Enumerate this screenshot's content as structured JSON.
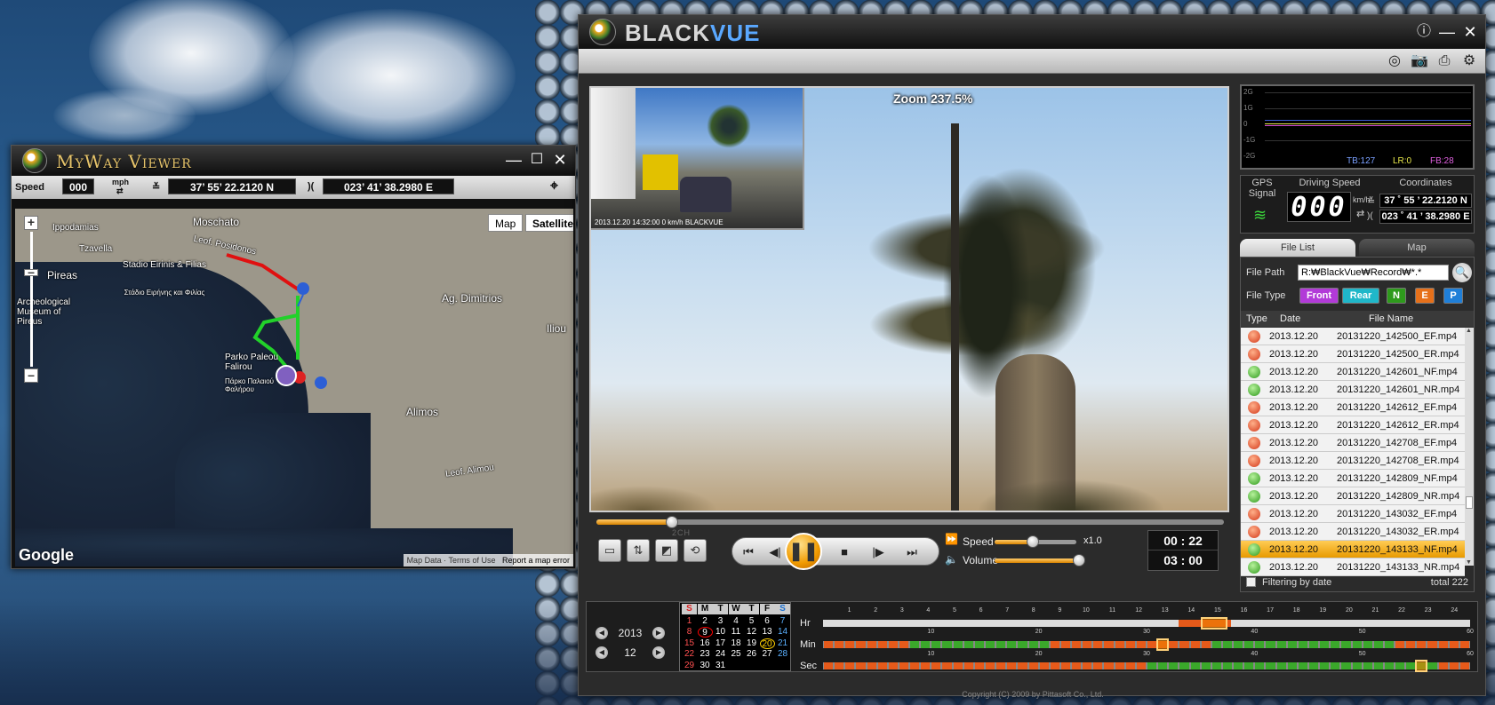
{
  "myway": {
    "title": "MyWay Viewer",
    "speed_label": "Speed",
    "speed_value": "000",
    "speed_unit": "mph",
    "lat": "37’ 55’ 22.2120 N",
    "lon": "023’ 41’ 38.2980 E",
    "map_btn": "Map",
    "satellite_btn": "Satellite",
    "labels": {
      "moschato": "Moschato",
      "pireas": "Pireas",
      "tzavella": "Tzavella",
      "stadio": "Stadio Eirinis & Filias",
      "stadio_gr": "Στάδιο Ειρήνης και Φιλίας",
      "ag_dimitrios": "Ag. Dimitrios",
      "iliou": "Iliou",
      "parko": "Parko Paleou Falirou",
      "parko_gr": "Πάρκο Παλαιού Φαλήρου",
      "alimos": "Alimos",
      "poseidonos": "Leof. Posidonos",
      "lefkimou": "Leof. Alimou",
      "ippodamias": "Ippodamias",
      "museum": "Archeological Museum of Pireus"
    },
    "footer": {
      "map_data": "Map Data",
      "terms": "Terms of Use",
      "report": "Report a map error"
    },
    "google": "Google"
  },
  "blackvue": {
    "title_black": "BLACK",
    "title_vue": "VUE",
    "zoom": "Zoom 237.5%",
    "osd": "2013.12.20 14:32:00  0 km/h   BLACKVUE",
    "ch_label": "2CH",
    "speed_label": "Speed",
    "speed_mult": "x1.0",
    "volume_label": "Volume",
    "playback_fraction": 0.12,
    "speed_fraction": 0.47,
    "volume_fraction": 0.95,
    "time_current": "00 : 22",
    "time_total": "03 : 00",
    "graph": {
      "y_labels": [
        "2G",
        "1G",
        "0",
        "-1G",
        "-2G"
      ],
      "tb": "TB:127",
      "lr": "LR:0",
      "fb": "FB:28"
    },
    "gps": {
      "signal_label": "GPS Signal",
      "speed_label": "Driving Speed",
      "speed_value": "000",
      "speed_unit": "km/h",
      "coord_label": "Coordinates",
      "lat": "37 ˚ 55 ’ 22.2120 N",
      "lon": "023 ˚ 41 ’ 38.2980 E"
    },
    "tabs": {
      "file_list": "File List",
      "map": "Map"
    },
    "file_path_label": "File Path",
    "file_path": "R:₩BlackVue₩Record₩*.*",
    "file_type_label": "File Type",
    "file_types": {
      "front": "Front",
      "rear": "Rear",
      "n": "N",
      "e": "E",
      "p": "P"
    },
    "list_head": {
      "type": "Type",
      "date": "Date",
      "name": "File Name"
    },
    "files": [
      {
        "t": "E",
        "date": "2013.12.20",
        "name": "20131220_142500_EF.mp4"
      },
      {
        "t": "E",
        "date": "2013.12.20",
        "name": "20131220_142500_ER.mp4"
      },
      {
        "t": "N",
        "date": "2013.12.20",
        "name": "20131220_142601_NF.mp4"
      },
      {
        "t": "N",
        "date": "2013.12.20",
        "name": "20131220_142601_NR.mp4"
      },
      {
        "t": "E",
        "date": "2013.12.20",
        "name": "20131220_142612_EF.mp4"
      },
      {
        "t": "E",
        "date": "2013.12.20",
        "name": "20131220_142612_ER.mp4"
      },
      {
        "t": "E",
        "date": "2013.12.20",
        "name": "20131220_142708_EF.mp4"
      },
      {
        "t": "E",
        "date": "2013.12.20",
        "name": "20131220_142708_ER.mp4"
      },
      {
        "t": "N",
        "date": "2013.12.20",
        "name": "20131220_142809_NF.mp4"
      },
      {
        "t": "N",
        "date": "2013.12.20",
        "name": "20131220_142809_NR.mp4"
      },
      {
        "t": "E",
        "date": "2013.12.20",
        "name": "20131220_143032_EF.mp4"
      },
      {
        "t": "E",
        "date": "2013.12.20",
        "name": "20131220_143032_ER.mp4"
      },
      {
        "t": "N",
        "date": "2013.12.20",
        "name": "20131220_143133_NF.mp4",
        "selected": true
      },
      {
        "t": "N",
        "date": "2013.12.20",
        "name": "20131220_143133_NR.mp4"
      }
    ],
    "filter_label": "Filtering by date",
    "total": "total 222",
    "year": "2013",
    "month": "12",
    "cal_head": [
      "S",
      "M",
      "T",
      "W",
      "T",
      "F",
      "S"
    ],
    "cal_days": [
      [
        "",
        "",
        "",
        "",
        "",
        "",
        ""
      ],
      [
        "1",
        "2",
        "3",
        "4",
        "5",
        "6",
        "7"
      ],
      [
        "8",
        "9",
        "10",
        "11",
        "12",
        "13",
        "14"
      ],
      [
        "15",
        "16",
        "17",
        "18",
        "19",
        "20",
        "21"
      ],
      [
        "22",
        "23",
        "24",
        "25",
        "26",
        "27",
        "28"
      ],
      [
        "29",
        "30",
        "31",
        "",
        "",
        "",
        ""
      ]
    ],
    "hr_label": "Hr",
    "min_label": "Min",
    "sec_label": "Sec",
    "hr_ticks": [
      "1",
      "2",
      "3",
      "4",
      "5",
      "6",
      "7",
      "8",
      "9",
      "10",
      "11",
      "12",
      "13",
      "14",
      "15",
      "16",
      "17",
      "18",
      "19",
      "20",
      "21",
      "22",
      "23",
      "24"
    ],
    "min_ticks": [
      "10",
      "20",
      "30",
      "40",
      "50",
      "60"
    ],
    "copyright": "Copyright (C) 2009 by Pittasoft Co., Ltd.",
    "colors": {
      "accent": "#f09a00",
      "event": "#e65a1a",
      "normal": "#3aa82a"
    }
  }
}
